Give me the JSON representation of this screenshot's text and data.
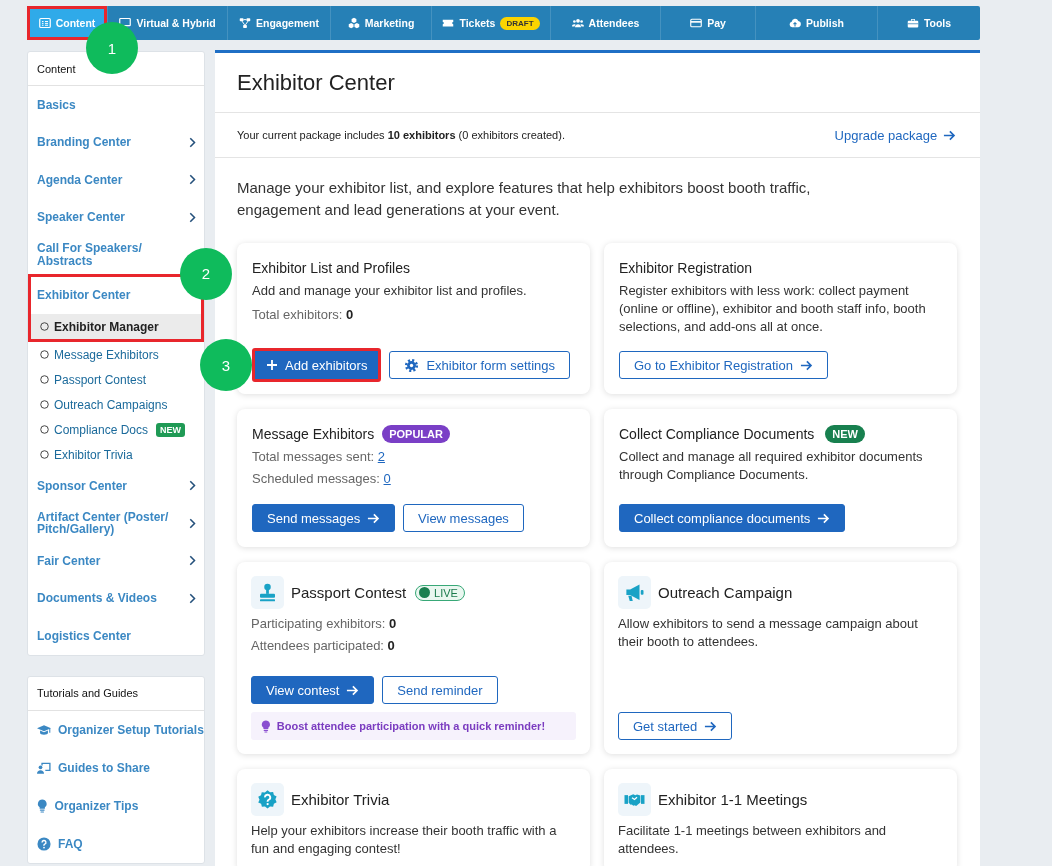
{
  "nav": {
    "tabs": [
      {
        "label": "Content",
        "selected": true,
        "step": "1"
      },
      {
        "label": "Virtual & Hybrid",
        "selected": false
      },
      {
        "label": "Engagement",
        "selected": false
      },
      {
        "label": "Marketing",
        "selected": false
      },
      {
        "label": "Tickets",
        "selected": false,
        "badge": "DRAFT"
      },
      {
        "label": "Attendees",
        "selected": false
      },
      {
        "label": "Pay",
        "selected": false
      },
      {
        "label": "Publish",
        "selected": false
      },
      {
        "label": "Tools",
        "selected": false
      }
    ]
  },
  "sidebar": {
    "header": "Content",
    "items": [
      {
        "label": "Basics",
        "submenu": false
      },
      {
        "label": "Branding Center",
        "submenu": true
      },
      {
        "label": "Agenda Center",
        "submenu": true
      },
      {
        "label": "Speaker Center",
        "submenu": true
      },
      {
        "label": "Call For Speakers/ Abstracts",
        "submenu": false
      },
      {
        "label": "Exhibitor Center",
        "submenu": false,
        "step": "2",
        "children": [
          {
            "label": "Exhibitor Manager",
            "selected": true
          },
          {
            "label": "Message Exhibitors",
            "selected": false
          },
          {
            "label": "Passport Contest",
            "selected": false
          },
          {
            "label": "Outreach Campaigns",
            "selected": false
          },
          {
            "label": "Compliance Docs",
            "selected": false,
            "badge": "NEW"
          },
          {
            "label": "Exhibitor Trivia",
            "selected": false
          }
        ]
      },
      {
        "label": "Sponsor Center",
        "submenu": true
      },
      {
        "label": "Artifact Center (Poster/ Pitch/Gallery)",
        "submenu": true
      },
      {
        "label": "Fair Center",
        "submenu": true
      },
      {
        "label": "Documents & Videos",
        "submenu": true
      },
      {
        "label": "Logistics Center",
        "submenu": false
      }
    ]
  },
  "guides": {
    "header": "Tutorials and Guides",
    "items": [
      {
        "label": "Organizer Setup Tutorials"
      },
      {
        "label": "Guides to Share"
      },
      {
        "label": "Organizer Tips"
      },
      {
        "label": "FAQ"
      }
    ]
  },
  "main": {
    "title": "Exhibitor Center",
    "package_note": "Your current package includes **10 exhibitors** (0 exhibitors created).",
    "upgrade_link": "Upgrade package",
    "intro": "Manage your exhibitor list, and explore features that help exhibitors boost booth traffic, engagement and lead generations at your event.",
    "cards": [
      {
        "title": "Exhibitor List and Profiles",
        "description": "Add and manage your exhibitor list and profiles.",
        "stats": [
          {
            "label": "Total exhibitors:",
            "value": "0",
            "kind": "count"
          }
        ],
        "buttons": [
          {
            "label": "Add exhibitors",
            "kind": "primary",
            "step": "3"
          },
          {
            "label": "Exhibitor form settings",
            "kind": "outline"
          }
        ]
      },
      {
        "title": "Exhibitor Registration",
        "description": "Register exhibitors with less work: collect payment (online or offline), exhibitor and booth staff info, booth selections, and add-ons all at once.",
        "buttons": [
          {
            "label": "Go to Exhibitor Registration",
            "kind": "outline"
          }
        ]
      },
      {
        "title": "Message Exhibitors",
        "badge": {
          "text": "POPULAR",
          "kind": "popular"
        },
        "stats": [
          {
            "label": "Total messages sent:",
            "value": "2",
            "kind": "link"
          },
          {
            "label": "Scheduled messages:",
            "value": "0",
            "kind": "link"
          }
        ],
        "buttons": [
          {
            "label": "Send messages",
            "kind": "primary"
          },
          {
            "label": "View messages",
            "kind": "outline"
          }
        ]
      },
      {
        "title": "Collect Compliance Documents",
        "badge": {
          "text": "NEW",
          "kind": "new"
        },
        "description": "Collect and manage all required exhibitor documents through Compliance Documents.",
        "buttons": [
          {
            "label": "Collect compliance documents",
            "kind": "primary"
          }
        ]
      },
      {
        "title": "Passport Contest",
        "badge": {
          "text": "LIVE",
          "kind": "live"
        },
        "stats": [
          {
            "label": "Participating exhibitors:",
            "value": "0",
            "kind": "count"
          },
          {
            "label": "Attendees participated:",
            "value": "0",
            "kind": "count"
          }
        ],
        "buttons": [
          {
            "label": "View contest",
            "kind": "primary"
          },
          {
            "label": "Send reminder",
            "kind": "outline"
          }
        ],
        "tip": "Boost attendee participation with a quick reminder!"
      },
      {
        "title": "Outreach Campaign",
        "description": "Allow exhibitors to send a message campaign about their booth to attendees.",
        "buttons": [
          {
            "label": "Get started",
            "kind": "outline"
          }
        ]
      },
      {
        "title": "Exhibitor Trivia",
        "description": "Help your exhibitors increase their booth traffic with a fun and engaging contest!"
      },
      {
        "title": "Exhibitor 1-1 Meetings",
        "description": "Facilitate 1-1 meetings between exhibitors and attendees."
      }
    ]
  }
}
